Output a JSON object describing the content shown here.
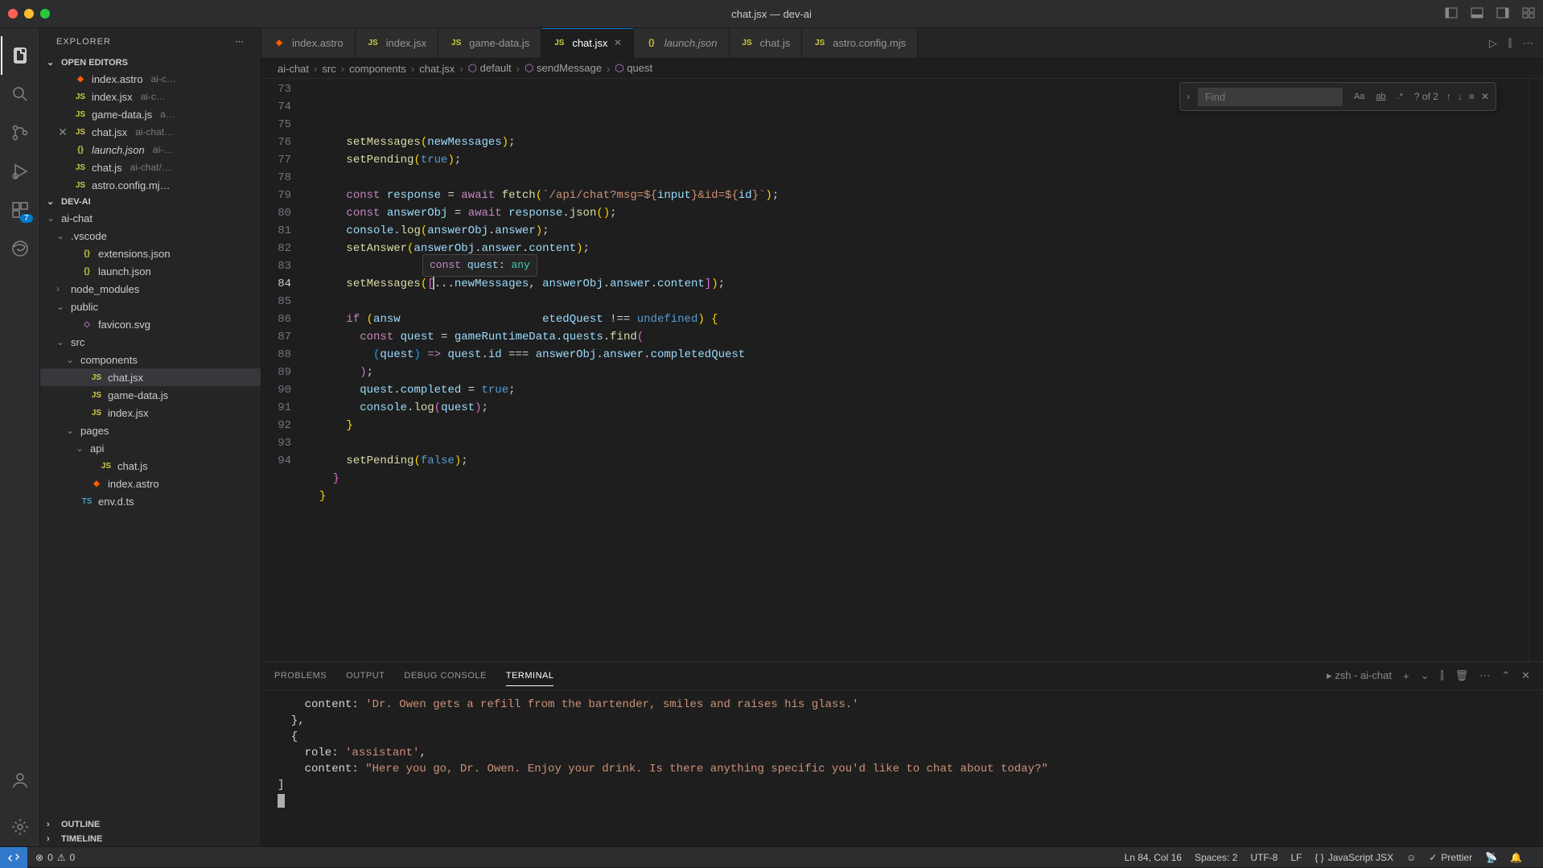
{
  "window": {
    "title": "chat.jsx — dev-ai"
  },
  "sidebar": {
    "title": "EXPLORER",
    "open_editors_label": "OPEN EDITORS",
    "project_label": "DEV-AI",
    "outline_label": "OUTLINE",
    "timeline_label": "TIMELINE",
    "open_editors": [
      {
        "name": "index.astro",
        "meta": "ai-c…",
        "icon": "astro"
      },
      {
        "name": "index.jsx",
        "meta": "ai-c…",
        "icon": "js"
      },
      {
        "name": "game-data.js",
        "meta": "a…",
        "icon": "js"
      },
      {
        "name": "chat.jsx",
        "meta": "ai-chat…",
        "icon": "js",
        "closable": true
      },
      {
        "name": "launch.json",
        "meta": "ai-…",
        "icon": "json",
        "italic": true
      },
      {
        "name": "chat.js",
        "meta": "ai-chat/…",
        "icon": "js"
      },
      {
        "name": "astro.config.mj…",
        "meta": "",
        "icon": "js"
      }
    ],
    "tree": [
      {
        "indent": 0,
        "type": "folder",
        "open": true,
        "name": "ai-chat"
      },
      {
        "indent": 1,
        "type": "folder",
        "open": true,
        "name": ".vscode"
      },
      {
        "indent": 2,
        "type": "file",
        "icon": "json",
        "name": "extensions.json"
      },
      {
        "indent": 2,
        "type": "file",
        "icon": "json",
        "name": "launch.json"
      },
      {
        "indent": 1,
        "type": "folder",
        "open": false,
        "name": "node_modules"
      },
      {
        "indent": 1,
        "type": "folder",
        "open": true,
        "name": "public"
      },
      {
        "indent": 2,
        "type": "file",
        "icon": "svg",
        "name": "favicon.svg"
      },
      {
        "indent": 1,
        "type": "folder",
        "open": true,
        "name": "src"
      },
      {
        "indent": 2,
        "type": "folder",
        "open": true,
        "name": "components"
      },
      {
        "indent": 3,
        "type": "file",
        "icon": "js",
        "name": "chat.jsx",
        "active": true
      },
      {
        "indent": 3,
        "type": "file",
        "icon": "js",
        "name": "game-data.js"
      },
      {
        "indent": 3,
        "type": "file",
        "icon": "js",
        "name": "index.jsx"
      },
      {
        "indent": 2,
        "type": "folder",
        "open": true,
        "name": "pages"
      },
      {
        "indent": 3,
        "type": "folder",
        "open": true,
        "name": "api"
      },
      {
        "indent": 4,
        "type": "file",
        "icon": "js",
        "name": "chat.js"
      },
      {
        "indent": 3,
        "type": "file",
        "icon": "astro",
        "name": "index.astro"
      },
      {
        "indent": 2,
        "type": "file",
        "icon": "ts",
        "name": "env.d.ts"
      }
    ]
  },
  "activity_badge": "7",
  "tabs": [
    {
      "label": "index.astro",
      "icon": "astro"
    },
    {
      "label": "index.jsx",
      "icon": "js"
    },
    {
      "label": "game-data.js",
      "icon": "js"
    },
    {
      "label": "chat.jsx",
      "icon": "js",
      "active": true,
      "close": true
    },
    {
      "label": "launch.json",
      "icon": "json",
      "italic": true
    },
    {
      "label": "chat.js",
      "icon": "js"
    },
    {
      "label": "astro.config.mjs",
      "icon": "js"
    }
  ],
  "breadcrumb": [
    "ai-chat",
    "src",
    "components",
    "chat.jsx",
    "default",
    "sendMessage",
    "quest"
  ],
  "find": {
    "placeholder": "Find",
    "count": "? of 2"
  },
  "code": {
    "lines": [
      73,
      74,
      75,
      76,
      77,
      78,
      79,
      80,
      81,
      82,
      83,
      84,
      85,
      86,
      87,
      88,
      89,
      90,
      91,
      92,
      93,
      94
    ],
    "current_line": 84,
    "hover": "const quest: any"
  },
  "panel": {
    "tabs": [
      "PROBLEMS",
      "OUTPUT",
      "DEBUG CONSOLE",
      "TERMINAL"
    ],
    "active": "TERMINAL",
    "shell": "zsh - ai-chat",
    "lines": [
      "    content: 'Dr. Owen gets a refill from the bartender, smiles and raises his glass.'",
      "  },",
      "  {",
      "    role: 'assistant',",
      "    content: \"Here you go, Dr. Owen. Enjoy your drink. Is there anything specific you'd like to chat about today?\"",
      "]",
      ""
    ]
  },
  "status": {
    "errors": "0",
    "warnings": "0",
    "cursor": "Ln 84, Col 16",
    "spaces": "Spaces: 2",
    "encoding": "UTF-8",
    "eol": "LF",
    "lang": "JavaScript JSX",
    "prettier": "Prettier"
  }
}
